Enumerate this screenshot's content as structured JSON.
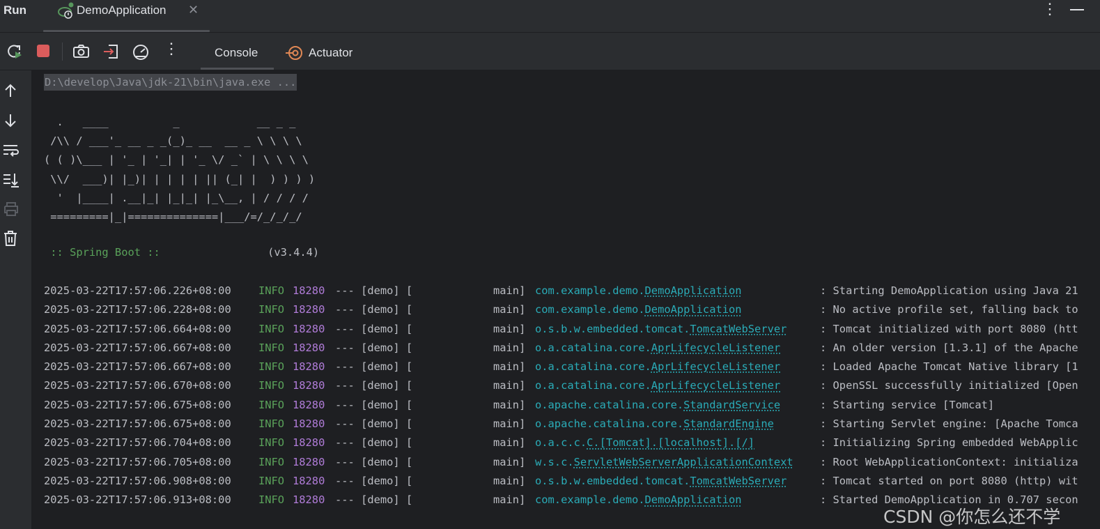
{
  "header": {
    "title": "Run",
    "tab_label": "DemoApplication",
    "close_glyph": "✕",
    "kebab_glyph": "⋮"
  },
  "toolbar": {
    "icons": [
      "rerun-icon",
      "stop-icon",
      "camera-icon",
      "exit-icon",
      "gauge-icon",
      "more-icon"
    ],
    "tabs": [
      {
        "label": "Console",
        "selected": true
      },
      {
        "label": "Actuator",
        "selected": false
      }
    ],
    "more_glyph": "⋮"
  },
  "gutter": {
    "icons": [
      "arrow-up-icon",
      "arrow-down-icon",
      "soft-wrap-icon",
      "scroll-to-end-icon",
      "print-icon",
      "trash-icon"
    ]
  },
  "console": {
    "command": "D:\\develop\\Java\\jdk-21\\bin\\java.exe ...",
    "banner": [
      "  .   ____          _            __ _ _",
      " /\\\\ / ___'_ __ _ _(_)_ __  __ _ \\ \\ \\ \\",
      "( ( )\\___ | '_ | '_| | '_ \\/ _` | \\ \\ \\ \\",
      " \\\\/  ___)| |_)| | | | | || (_| |  ) ) ) )",
      "  '  |____| .__|_| |_|_| |_\\__, | / / / /",
      " =========|_|==============|___/=/_/_/_/"
    ],
    "spring_label": " :: Spring Boot :: ",
    "spring_version": "(v3.4.4)",
    "logs": [
      {
        "ts": "2025-03-22T17:57:06.226+08:00",
        "level": "INFO",
        "pid": "18280",
        "sep": "--- [demo] [",
        "thread": "main]",
        "logger_pkg": "com.example.demo.",
        "logger_cls": "DemoApplication",
        "msg": ": Starting DemoApplication using Java 21"
      },
      {
        "ts": "2025-03-22T17:57:06.228+08:00",
        "level": "INFO",
        "pid": "18280",
        "sep": "--- [demo] [",
        "thread": "main]",
        "logger_pkg": "com.example.demo.",
        "logger_cls": "DemoApplication",
        "msg": ": No active profile set, falling back to"
      },
      {
        "ts": "2025-03-22T17:57:06.664+08:00",
        "level": "INFO",
        "pid": "18280",
        "sep": "--- [demo] [",
        "thread": "main]",
        "logger_pkg": "o.s.b.w.embedded.tomcat.",
        "logger_cls": "TomcatWebServer",
        "msg": ": Tomcat initialized with port 8080 (htt"
      },
      {
        "ts": "2025-03-22T17:57:06.667+08:00",
        "level": "INFO",
        "pid": "18280",
        "sep": "--- [demo] [",
        "thread": "main]",
        "logger_pkg": "o.a.catalina.core.",
        "logger_cls": "AprLifecycleListener",
        "msg": ": An older version [1.3.1] of the Apache"
      },
      {
        "ts": "2025-03-22T17:57:06.667+08:00",
        "level": "INFO",
        "pid": "18280",
        "sep": "--- [demo] [",
        "thread": "main]",
        "logger_pkg": "o.a.catalina.core.",
        "logger_cls": "AprLifecycleListener",
        "msg": ": Loaded Apache Tomcat Native library [1"
      },
      {
        "ts": "2025-03-22T17:57:06.670+08:00",
        "level": "INFO",
        "pid": "18280",
        "sep": "--- [demo] [",
        "thread": "main]",
        "logger_pkg": "o.a.catalina.core.",
        "logger_cls": "AprLifecycleListener",
        "msg": ": OpenSSL successfully initialized [Open"
      },
      {
        "ts": "2025-03-22T17:57:06.675+08:00",
        "level": "INFO",
        "pid": "18280",
        "sep": "--- [demo] [",
        "thread": "main]",
        "logger_pkg": "o.apache.catalina.core.",
        "logger_cls": "StandardService",
        "msg": ": Starting service [Tomcat]"
      },
      {
        "ts": "2025-03-22T17:57:06.675+08:00",
        "level": "INFO",
        "pid": "18280",
        "sep": "--- [demo] [",
        "thread": "main]",
        "logger_pkg": "o.apache.catalina.core.",
        "logger_cls": "StandardEngine",
        "msg": ": Starting Servlet engine: [Apache Tomca"
      },
      {
        "ts": "2025-03-22T17:57:06.704+08:00",
        "level": "INFO",
        "pid": "18280",
        "sep": "--- [demo] [",
        "thread": "main]",
        "logger_pkg": "o.a.c.c.",
        "logger_cls": "C.[Tomcat].[localhost].[/]",
        "msg": ": Initializing Spring embedded WebApplic"
      },
      {
        "ts": "2025-03-22T17:57:06.705+08:00",
        "level": "INFO",
        "pid": "18280",
        "sep": "--- [demo] [",
        "thread": "main]",
        "logger_pkg": "w.s.c.",
        "logger_cls": "ServletWebServerApplicationContext",
        "msg": ": Root WebApplicationContext: initializa"
      },
      {
        "ts": "2025-03-22T17:57:06.908+08:00",
        "level": "INFO",
        "pid": "18280",
        "sep": "--- [demo] [",
        "thread": "main]",
        "logger_pkg": "o.s.b.w.embedded.tomcat.",
        "logger_cls": "TomcatWebServer",
        "msg": ": Tomcat started on port 8080 (http) wit"
      },
      {
        "ts": "2025-03-22T17:57:06.913+08:00",
        "level": "INFO",
        "pid": "18280",
        "sep": "--- [demo] [",
        "thread": "main]",
        "logger_pkg": "com.example.demo.",
        "logger_cls": "DemoApplication",
        "msg": ": Started DemoApplication in 0.707 secon"
      }
    ]
  },
  "watermark": "CSDN @你怎么还不学",
  "colors": {
    "background": "#1e1f22",
    "panel": "#2b2d30",
    "text": "#bcbec4",
    "info_green": "#5aa25a",
    "pid_purple": "#b07cd8",
    "logger_cyan": "#2aacb8",
    "stop_red": "#db5c5c",
    "rerun_green": "#57965c",
    "actuator_orange": "#e08855"
  }
}
